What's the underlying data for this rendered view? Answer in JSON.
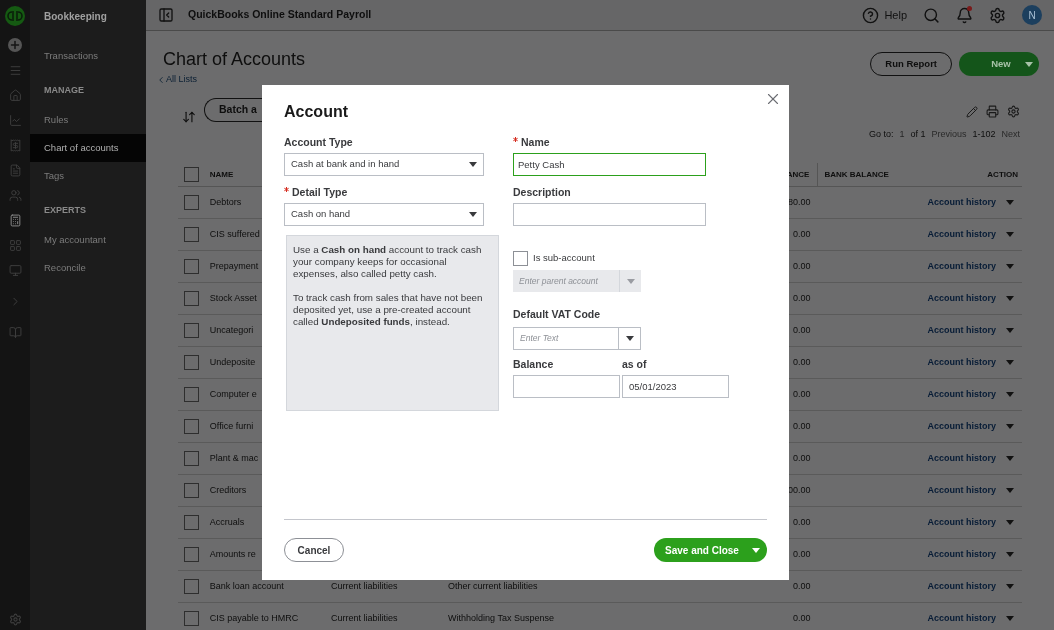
{
  "rail": [
    {
      "selected": false
    },
    {
      "selected": false
    },
    {
      "selected": false
    },
    {
      "selected": false
    },
    {
      "selected": false
    },
    {
      "selected": false
    },
    {
      "selected": false
    },
    {
      "selected": true
    },
    {
      "selected": false
    },
    {
      "selected": false
    },
    {
      "selected": false
    },
    {
      "selected": false
    }
  ],
  "sidebar": {
    "title": "Bookkeeping",
    "sections": [
      {
        "items": [
          {
            "label": "Transactions",
            "selected": false
          }
        ]
      },
      {
        "heading": "MANAGE",
        "items": [
          {
            "label": "Rules",
            "selected": false
          },
          {
            "label": "Chart of accounts",
            "selected": true
          },
          {
            "label": "Tags",
            "selected": false
          }
        ]
      },
      {
        "heading": "EXPERTS",
        "items": [
          {
            "label": "My accountant",
            "selected": false
          },
          {
            "label": "Reconcile",
            "selected": false
          }
        ]
      }
    ]
  },
  "topbar": {
    "title": "QuickBooks Online Standard Payroll",
    "help": "Help",
    "avatar": "N",
    "notification": true
  },
  "page": {
    "title": "Chart of Accounts",
    "back_link": "All Lists",
    "run_report": "Run Report",
    "new": "New",
    "batch": "Batch a"
  },
  "pagination": {
    "goto": "Go to:",
    "page": "1",
    "of": "of 1",
    "previous": "Previous",
    "range": "1-102",
    "next": "Next"
  },
  "table": {
    "headers": {
      "name": "NAME",
      "balance": "ANCE",
      "bank_balance": "BANK BALANCE",
      "action": "ACTION"
    },
    "header_checked": false,
    "rows": [
      {
        "name": "Debtors",
        "balance": "80.00",
        "action": "Account history",
        "checked": false
      },
      {
        "name": "CIS suffered",
        "balance": "0.00",
        "action": "Account history",
        "checked": false
      },
      {
        "name": "Prepayment",
        "balance": "0.00",
        "action": "Account history",
        "checked": false
      },
      {
        "name": "Stock Asset",
        "balance": "0.00",
        "action": "Account history",
        "checked": false
      },
      {
        "name": "Uncategori",
        "balance": "0.00",
        "action": "Account history",
        "checked": false
      },
      {
        "name": "Undeposite",
        "balance": "0.00",
        "action": "Account history",
        "checked": false
      },
      {
        "name": "Computer e",
        "balance": "0.00",
        "action": "Account history",
        "checked": false
      },
      {
        "name": "Office furni",
        "balance": "0.00",
        "action": "Account history",
        "checked": false
      },
      {
        "name": "Plant & mac",
        "balance": "0.00",
        "action": "Account history",
        "checked": false
      },
      {
        "name": "Creditors",
        "balance": "00.00",
        "action": "Account history",
        "checked": false
      },
      {
        "name": "Accruals",
        "balance": "0.00",
        "action": "Account history",
        "checked": false
      },
      {
        "name": "Amounts re",
        "balance": "0.00",
        "action": "Account history",
        "checked": false
      },
      {
        "name": "Bank loan account",
        "type": "Current liabilities",
        "detail_type": "Other current liabilities",
        "balance": "0.00",
        "action": "Account history",
        "checked": false
      },
      {
        "name": "CIS payable to HMRC",
        "type": "Current liabilities",
        "detail_type": "Withholding Tax Suspense",
        "balance": "0.00",
        "action": "Account history",
        "checked": false
      }
    ]
  },
  "dialog": {
    "title": "Account",
    "account_type": {
      "label": "Account Type",
      "value": "Cash at bank and in hand",
      "required": false
    },
    "detail_type": {
      "label": "Detail Type",
      "value": "Cash on hand",
      "required": true
    },
    "help_text": [
      "Use a **Cash on hand** account to track cash your company keeps for occasional expenses, also called petty cash.",
      "To track cash from sales that have not been deposited yet, use a pre-created account called **Undeposited funds**, instead."
    ],
    "name": {
      "label": "Name",
      "value": "Petty Cash",
      "required": true,
      "focused": true
    },
    "description": {
      "label": "Description",
      "required": false,
      "focused": false
    },
    "sub_account": {
      "label": "Is sub-account",
      "checked": false
    },
    "parent_account": {
      "placeholder": "Enter parent account",
      "disabled": true
    },
    "vat_code": {
      "label": "Default VAT Code",
      "placeholder": "Enter Text"
    },
    "balance": {
      "label": "Balance"
    },
    "as_of": {
      "label": "as of",
      "value": "05/01/2023"
    },
    "cancel": "Cancel",
    "save": "Save and Close"
  }
}
